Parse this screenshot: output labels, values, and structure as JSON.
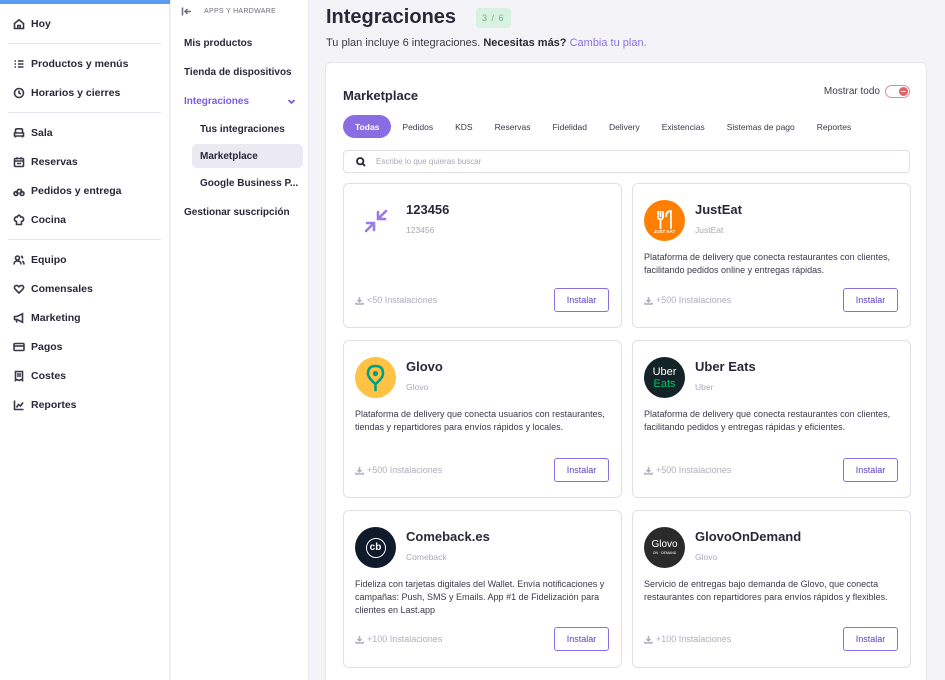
{
  "sidebar": {
    "groups": [
      [
        {
          "label": "Hoy",
          "icon": "home-icon"
        }
      ],
      [
        {
          "label": "Productos y menús",
          "icon": "list-icon"
        },
        {
          "label": "Horarios y cierres",
          "icon": "clock-icon"
        }
      ],
      [
        {
          "label": "Sala",
          "icon": "armchair-icon"
        },
        {
          "label": "Reservas",
          "icon": "calendar-icon"
        },
        {
          "label": "Pedidos y entrega",
          "icon": "bike-icon"
        },
        {
          "label": "Cocina",
          "icon": "chef-hat-icon"
        }
      ],
      [
        {
          "label": "Equipo",
          "icon": "users-icon"
        },
        {
          "label": "Comensales",
          "icon": "heart-icon"
        },
        {
          "label": "Marketing",
          "icon": "megaphone-icon"
        },
        {
          "label": "Pagos",
          "icon": "card-icon"
        },
        {
          "label": "Costes",
          "icon": "receipt-icon"
        },
        {
          "label": "Reportes",
          "icon": "chart-icon"
        }
      ]
    ]
  },
  "subnav": {
    "header": "APPS Y HARDWARE",
    "mis_productos": "Mis productos",
    "tienda": "Tienda de dispositivos",
    "integraciones": "Integraciones",
    "tus_integraciones": "Tus integraciones",
    "marketplace": "Marketplace",
    "google": "Google Business P...",
    "gestionar": "Gestionar suscripción"
  },
  "header": {
    "title": "Integraciones",
    "badge": "3 / 6",
    "plan_text": "Tu plan incluye 6 integraciones.",
    "plan_bold": "Necesitas más?",
    "plan_link": "Cambia tu plan."
  },
  "marketplace": {
    "title": "Marketplace",
    "show_all": "Mostrar todo",
    "tabs": [
      "Todas",
      "Pedidos",
      "KDS",
      "Reservas",
      "Fidelidad",
      "Delivery",
      "Existencias",
      "Sistemas de pago",
      "Reportes"
    ],
    "search_placeholder": "Escribe lo que quieras buscar",
    "install_label": "Instalar",
    "cards": [
      {
        "name": "123456",
        "sub": "123456",
        "desc": "",
        "installs": "<50 Instalaciones"
      },
      {
        "name": "JustEat",
        "sub": "JustEat",
        "desc": "Plataforma de delivery que conecta restaurantes con clientes, facilitando pedidos online y entregas rápidas.",
        "installs": "+500 Instalaciones",
        "logo_text": "JUST EAT"
      },
      {
        "name": "Glovo",
        "sub": "Glovo",
        "desc": "Plataforma de delivery que conecta usuarios con restaurantes, tiendas y repartidores para envíos rápidos y locales.",
        "installs": "+500 Instalaciones"
      },
      {
        "name": "Uber Eats",
        "sub": "Uber",
        "desc": "Plataforma de delivery que conecta restaurantes con clientes, facilitando pedidos y entregas rápidas y eficientes.",
        "installs": "+500 Instalaciones",
        "logo_text_1": "Uber",
        "logo_text_2": "Eats"
      },
      {
        "name": "Comeback.es",
        "sub": "Comeback",
        "desc": "Fideliza con tarjetas digitales del Wallet. Envía notificaciones y campañas: Push, SMS y Emails. App #1 de Fidelización para clientes en Last.app",
        "installs": "+100 Instalaciones",
        "logo_text": "cb"
      },
      {
        "name": "GlovoOnDemand",
        "sub": "Glovo",
        "desc": "Servicio de entregas bajo demanda de Glovo, que conecta restaurantes con repartidores para envíos rápidos y flexibles.",
        "installs": "+100 Instalaciones",
        "logo_text": "Glovo",
        "logo_subtext": "ON · DEMAND"
      }
    ]
  },
  "colors": {
    "accent": "#8a6de3",
    "justeat": "#ff8000",
    "glovo": "#ffc244",
    "uber": "#06c167"
  }
}
